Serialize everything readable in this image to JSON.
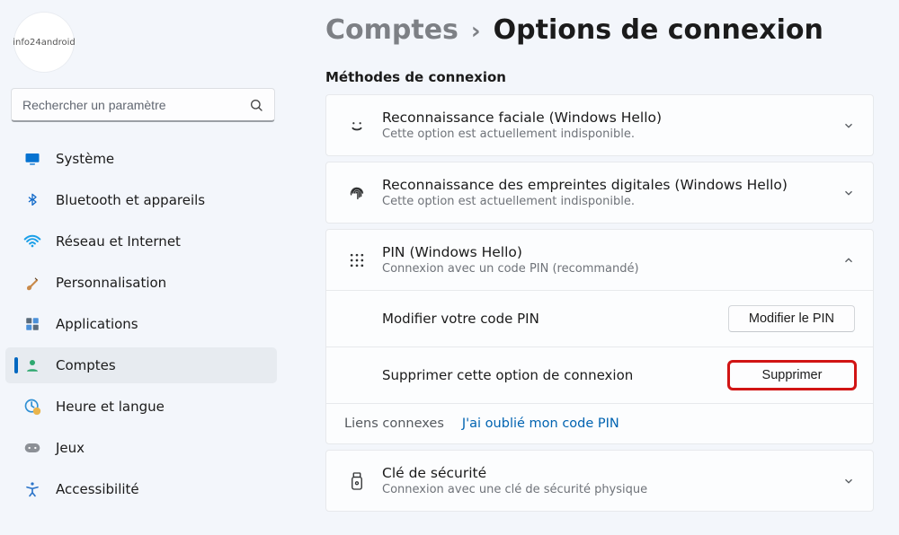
{
  "avatar_caption": "info24android",
  "search": {
    "placeholder": "Rechercher un paramètre"
  },
  "sidebar": {
    "items": [
      {
        "label": "Système"
      },
      {
        "label": "Bluetooth et appareils"
      },
      {
        "label": "Réseau et Internet"
      },
      {
        "label": "Personnalisation"
      },
      {
        "label": "Applications"
      },
      {
        "label": "Comptes"
      },
      {
        "label": "Heure et langue"
      },
      {
        "label": "Jeux"
      },
      {
        "label": "Accessibilité"
      }
    ]
  },
  "breadcrumb": {
    "parent": "Comptes",
    "sep": "›",
    "current": "Options de connexion"
  },
  "section_title": "Méthodes de connexion",
  "methods": {
    "face": {
      "title": "Reconnaissance faciale (Windows Hello)",
      "sub": "Cette option est actuellement indisponible."
    },
    "finger": {
      "title": "Reconnaissance des empreintes digitales (Windows Hello)",
      "sub": "Cette option est actuellement indisponible."
    },
    "pin": {
      "title": "PIN (Windows Hello)",
      "sub": "Connexion avec un code PIN (recommandé)",
      "row1_label": "Modifier votre code PIN",
      "row1_btn": "Modifier le PIN",
      "row2_label": "Supprimer cette option de connexion",
      "row2_btn": "Supprimer",
      "related_label": "Liens connexes",
      "related_link": "J'ai oublié mon code PIN"
    },
    "key": {
      "title": "Clé de sécurité",
      "sub": "Connexion avec une clé de sécurité physique"
    }
  }
}
